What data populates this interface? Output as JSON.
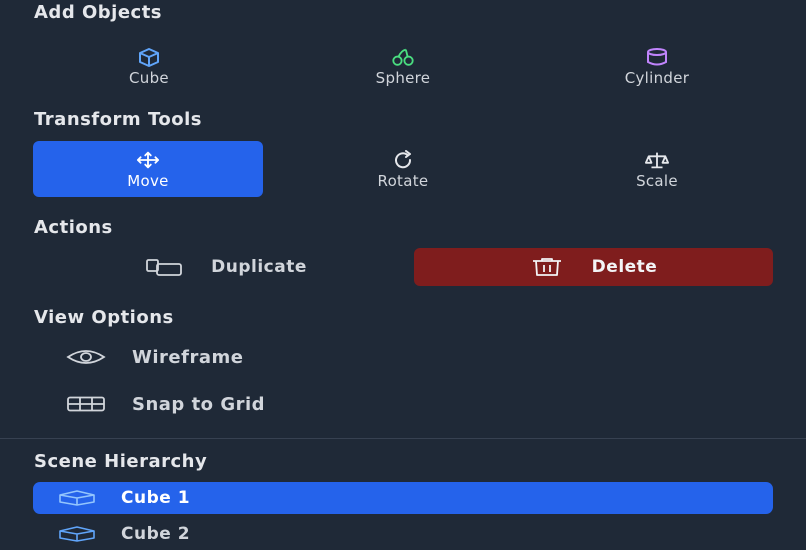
{
  "add_objects": {
    "heading": "Add Objects",
    "items": [
      {
        "label": "Cube",
        "icon": "cube-icon",
        "color": "#60a5fa"
      },
      {
        "label": "Sphere",
        "icon": "cherries-icon",
        "color": "#4ade80"
      },
      {
        "label": "Cylinder",
        "icon": "cylinder-icon",
        "color": "#c084fc"
      }
    ]
  },
  "transform_tools": {
    "heading": "Transform Tools",
    "items": [
      {
        "label": "Move",
        "icon": "move-icon",
        "active": true
      },
      {
        "label": "Rotate",
        "icon": "rotate-icon",
        "active": false
      },
      {
        "label": "Scale",
        "icon": "scale-icon",
        "active": false
      }
    ]
  },
  "actions": {
    "heading": "Actions",
    "duplicate_label": "Duplicate",
    "delete_label": "Delete"
  },
  "view_options": {
    "heading": "View Options",
    "wireframe_label": "Wireframe",
    "snap_label": "Snap to Grid"
  },
  "scene_hierarchy": {
    "heading": "Scene Hierarchy",
    "items": [
      {
        "label": "Cube 1",
        "selected": true
      },
      {
        "label": "Cube 2",
        "selected": false
      }
    ]
  },
  "colors": {
    "background": "#1f2937",
    "accent": "#2563eb",
    "danger": "#7f1d1d"
  }
}
